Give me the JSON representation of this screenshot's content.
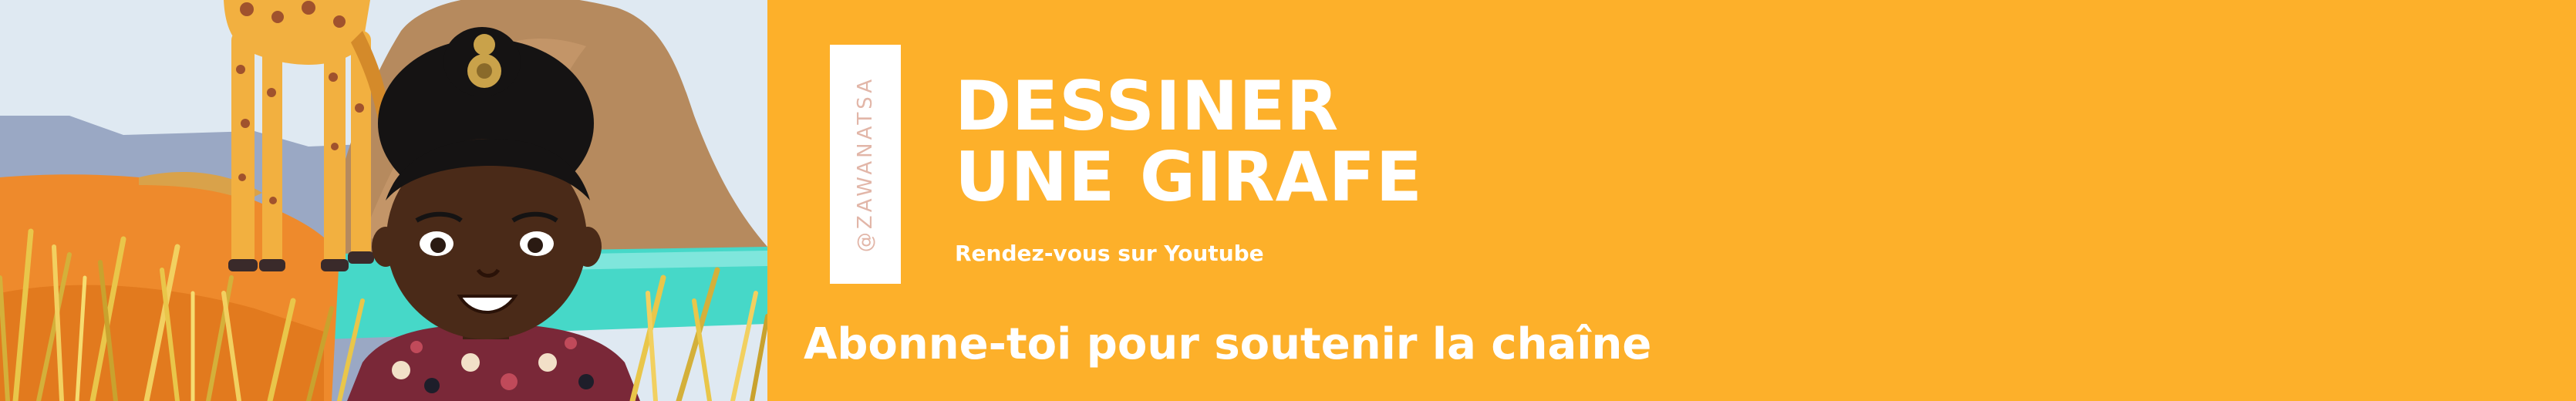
{
  "banner": {
    "handle": "@ZAWANATSA",
    "title_line1": "DESSINER",
    "title_line2": "UNE GIRAFE",
    "subtitle": "Rendez-vous sur Youtube",
    "call_to_action": "Abonne-toi pour soutenir la chaîne"
  },
  "colors": {
    "background": "#fdb02a",
    "text": "#ffffff",
    "handle_text": "#e2b6a8",
    "sky": "#dfe9f2",
    "water": "#46d8c8",
    "savanna": "#ee8a2c",
    "grass": "#e9c64a",
    "rock": "#b68a5e",
    "giraffe": "#f2b040",
    "skin": "#4a2a18"
  },
  "illustration": {
    "subjects": [
      "giraffe",
      "girl-avatar",
      "savanna",
      "rock",
      "water",
      "tall-grass"
    ]
  }
}
